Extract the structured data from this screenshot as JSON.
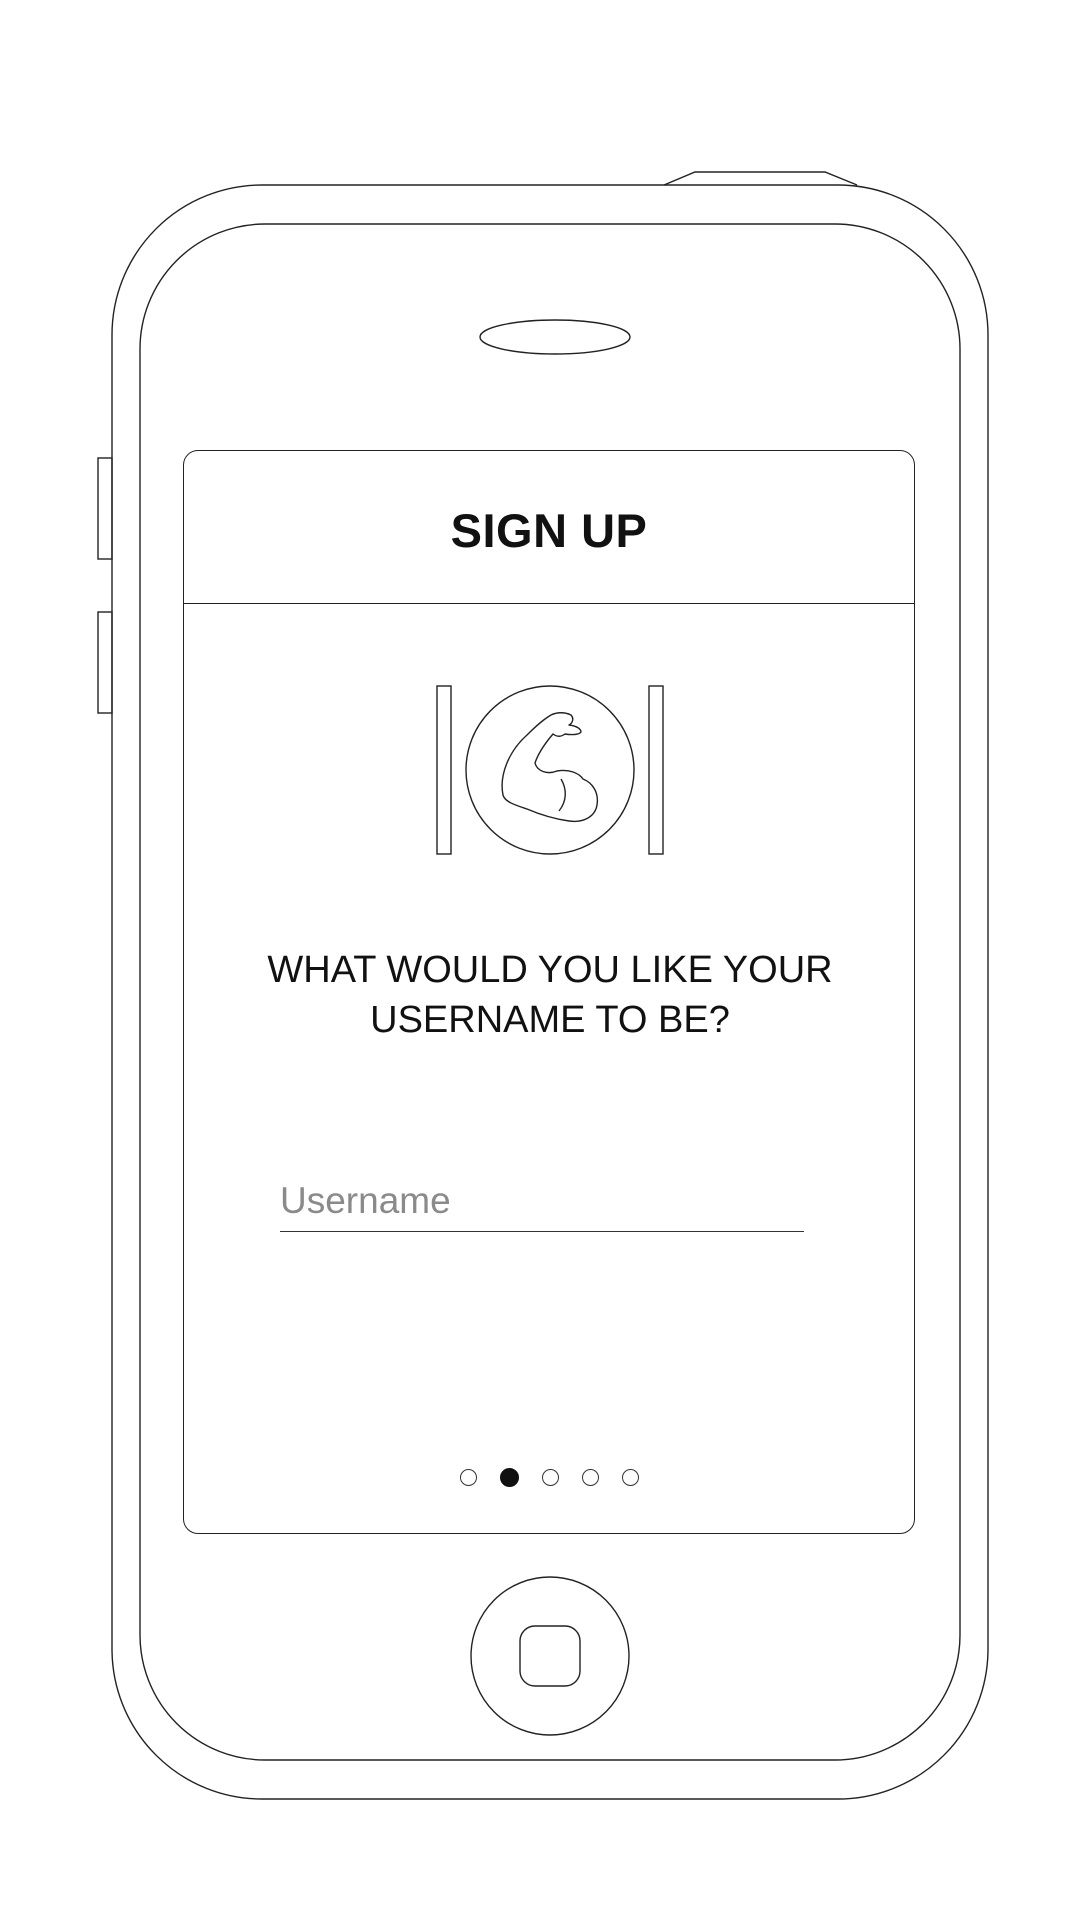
{
  "header": {
    "title": "SIGN UP"
  },
  "logo": {
    "icon": "flexed-bicep-icon"
  },
  "prompt": {
    "text": "WHAT WOULD YOU LIKE YOUR\nUSERNAME TO BE?"
  },
  "username": {
    "placeholder": "Username",
    "value": ""
  },
  "pager": {
    "total": 5,
    "current": 2
  },
  "colors": {
    "line": "#222222",
    "placeholder": "#8a8a8a",
    "active_dot": "#111111"
  }
}
